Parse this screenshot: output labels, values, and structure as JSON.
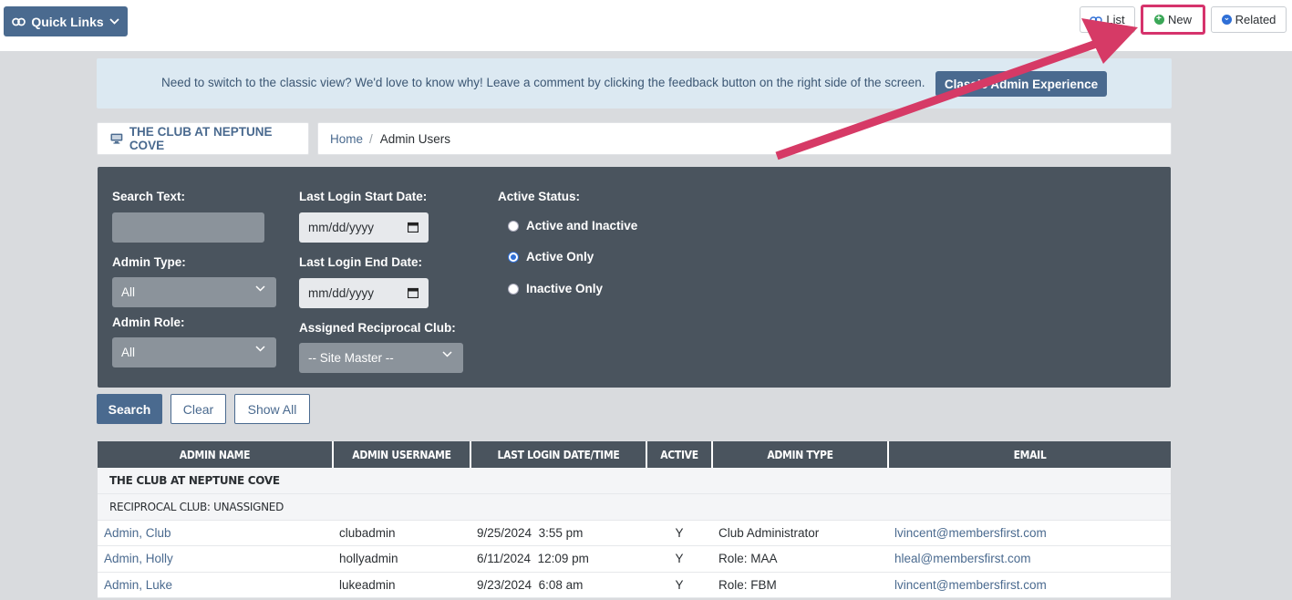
{
  "topbar": {
    "quick_links_label": "Quick Links",
    "list_label": "List",
    "new_label": "New",
    "related_label": "Related"
  },
  "notice": {
    "text": "Need to switch to the classic view? We'd love to know why! Leave a comment by clicking the feedback button on the right side of the screen.",
    "button_label": "Classic Admin Experience"
  },
  "club": {
    "name": "THE CLUB AT NEPTUNE COVE"
  },
  "breadcrumb": {
    "home": "Home",
    "separator": "/",
    "current": "Admin Users"
  },
  "filters": {
    "search_text_label": "Search Text:",
    "search_text_value": "",
    "admin_type_label": "Admin Type:",
    "admin_type_value": "All",
    "admin_role_label": "Admin Role:",
    "admin_role_value": "All",
    "last_login_start_label": "Last Login Start Date:",
    "last_login_start_placeholder": "mm/dd/yyyy",
    "last_login_end_label": "Last Login End Date:",
    "last_login_end_placeholder": "mm/dd/yyyy",
    "reciprocal_label": "Assigned Reciprocal Club:",
    "reciprocal_value": "-- Site Master --",
    "active_status_label": "Active Status:",
    "active_status_options": [
      "Active and Inactive",
      "Active Only",
      "Inactive Only"
    ],
    "active_status_selected": "Active Only"
  },
  "actions": {
    "search": "Search",
    "clear": "Clear",
    "show_all": "Show All"
  },
  "table": {
    "headers": [
      "ADMIN NAME",
      "ADMIN USERNAME",
      "LAST LOGIN DATE/TIME",
      "ACTIVE",
      "ADMIN TYPE",
      "EMAIL"
    ],
    "group": "THE CLUB AT NEPTUNE COVE",
    "subgroup": "RECIPROCAL CLUB: UNASSIGNED",
    "rows": [
      {
        "name": "Admin, Club",
        "username": "clubadmin",
        "date": "9/25/2024",
        "time": "3:55 pm",
        "active": "Y",
        "type": "Club Administrator",
        "email": "lvincent@membersfirst.com"
      },
      {
        "name": "Admin, Holly",
        "username": "hollyadmin",
        "date": "6/11/2024",
        "time": "12:09 pm",
        "active": "Y",
        "type": "Role: MAA",
        "email": "hleal@membersfirst.com"
      },
      {
        "name": "Admin, Luke",
        "username": "lukeadmin",
        "date": "9/23/2024",
        "time": "6:08 am",
        "active": "Y",
        "type": "Role: FBM",
        "email": "lvincent@membersfirst.com"
      }
    ]
  },
  "colors": {
    "accent": "#4a6a8f",
    "highlight": "#d6336c",
    "panel": "#4a545e"
  },
  "icons": [
    "link-icon",
    "chevron-down-icon",
    "monitor-icon",
    "calendar-icon",
    "plus-circle-icon",
    "chevron-circle-icon"
  ]
}
